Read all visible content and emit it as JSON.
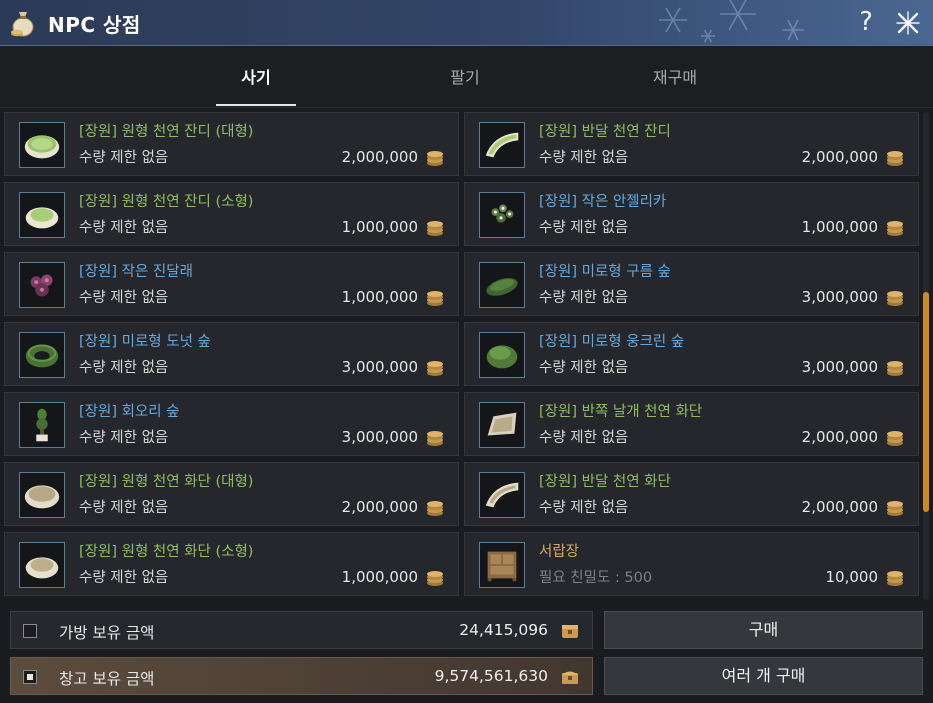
{
  "window": {
    "title": "NPC 상점"
  },
  "tabs": [
    {
      "label": "사기",
      "active": true
    },
    {
      "label": "팔기",
      "active": false
    },
    {
      "label": "재구매",
      "active": false
    }
  ],
  "items": [
    {
      "name": "[장원] 원형 천연 잔디 (대형)",
      "sub": "수량 제한 없음",
      "price": "2,000,000",
      "name_color": "green",
      "icon": "round-lawn-large-icon"
    },
    {
      "name": "[장원] 반달 천연 잔디",
      "sub": "수량 제한 없음",
      "price": "2,000,000",
      "name_color": "green",
      "icon": "half-moon-lawn-icon"
    },
    {
      "name": "[장원] 원형 천연 잔디 (소형)",
      "sub": "수량 제한 없음",
      "price": "1,000,000",
      "name_color": "green",
      "icon": "round-lawn-small-icon"
    },
    {
      "name": "[장원] 작은 안젤리카",
      "sub": "수량 제한 없음",
      "price": "1,000,000",
      "name_color": "blue",
      "icon": "angelica-plant-icon"
    },
    {
      "name": "[장원] 작은 진달래",
      "sub": "수량 제한 없음",
      "price": "1,000,000",
      "name_color": "blue",
      "icon": "azalea-plant-icon"
    },
    {
      "name": "[장원] 미로형 구름 숲",
      "sub": "수량 제한 없음",
      "price": "3,000,000",
      "name_color": "blue",
      "icon": "cloud-hedge-icon"
    },
    {
      "name": "[장원] 미로형 도넛 숲",
      "sub": "수량 제한 없음",
      "price": "3,000,000",
      "name_color": "blue",
      "icon": "donut-hedge-icon"
    },
    {
      "name": "[장원] 미로형 웅크린 숲",
      "sub": "수량 제한 없음",
      "price": "3,000,000",
      "name_color": "blue",
      "icon": "crouched-hedge-icon"
    },
    {
      "name": "[장원] 회오리 숲",
      "sub": "수량 제한 없음",
      "price": "3,000,000",
      "name_color": "blue",
      "icon": "topiary-icon"
    },
    {
      "name": "[장원] 반쪽 날개 천연 화단",
      "sub": "수량 제한 없음",
      "price": "2,000,000",
      "name_color": "green",
      "icon": "half-wing-flowerbed-icon"
    },
    {
      "name": "[장원] 원형 천연 화단 (대형)",
      "sub": "수량 제한 없음",
      "price": "2,000,000",
      "name_color": "green",
      "icon": "round-flowerbed-large-icon"
    },
    {
      "name": "[장원] 반달 천연 화단",
      "sub": "수량 제한 없음",
      "price": "2,000,000",
      "name_color": "green",
      "icon": "half-moon-flowerbed-icon"
    },
    {
      "name": "[장원] 원형 천연 화단 (소형)",
      "sub": "수량 제한 없음",
      "price": "1,000,000",
      "name_color": "green",
      "icon": "round-flowerbed-small-icon"
    },
    {
      "name": "서랍장",
      "sub": "필요 친밀도 : 500",
      "price": "10,000",
      "name_color": "plain",
      "icon": "drawer-chest-icon"
    }
  ],
  "bottom": {
    "inventory": {
      "label": "가방 보유 금액",
      "amount": "24,415,096",
      "checked": false
    },
    "storage": {
      "label": "창고 보유 금액",
      "amount": "9,574,561,630",
      "checked": true
    },
    "buy_label": "구매",
    "multi_buy_label": "여러 개 구매"
  },
  "colors": {
    "name_green": "#8fbd62",
    "name_blue": "#64a9df",
    "name_plain": "#d2a86a",
    "scroll_accent": "#c98a2e",
    "titlebar": "#33466a"
  }
}
